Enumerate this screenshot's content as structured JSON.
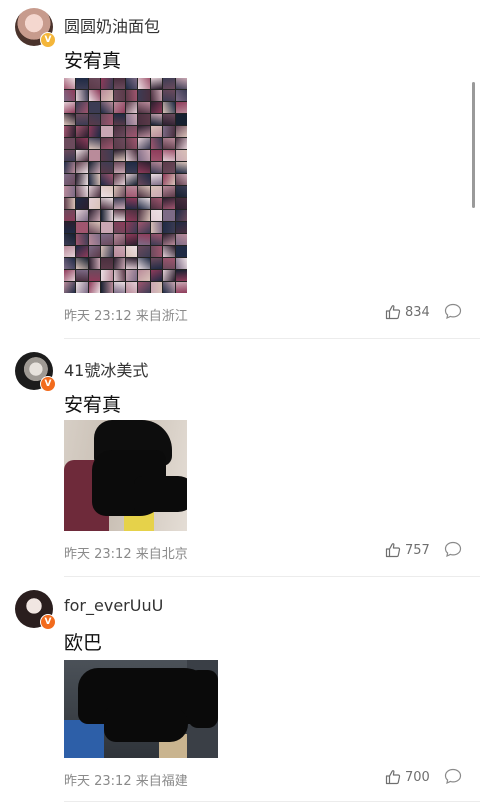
{
  "comments": [
    {
      "username": "圆圆奶油面包",
      "badge": "V",
      "text": "安宥真",
      "meta": "昨天 23:12 来自浙江",
      "likes": "834"
    },
    {
      "username": "41號冰美式",
      "badge": "V",
      "text": "安宥真",
      "meta": "昨天 23:12 来自北京",
      "likes": "757"
    },
    {
      "username": "for_everUuU",
      "badge": "V",
      "text": "欧巴",
      "meta": "昨天 23:12 来自福建",
      "likes": "700"
    }
  ],
  "icons": {
    "like": "thumbs-up-icon",
    "reply": "comment-bubble-icon",
    "badge": "verified-badge-icon"
  },
  "colors": {
    "badge_gold": "#f4b63a",
    "badge_orange": "#f26b1d",
    "meta_gray": "#8a8a8a"
  }
}
